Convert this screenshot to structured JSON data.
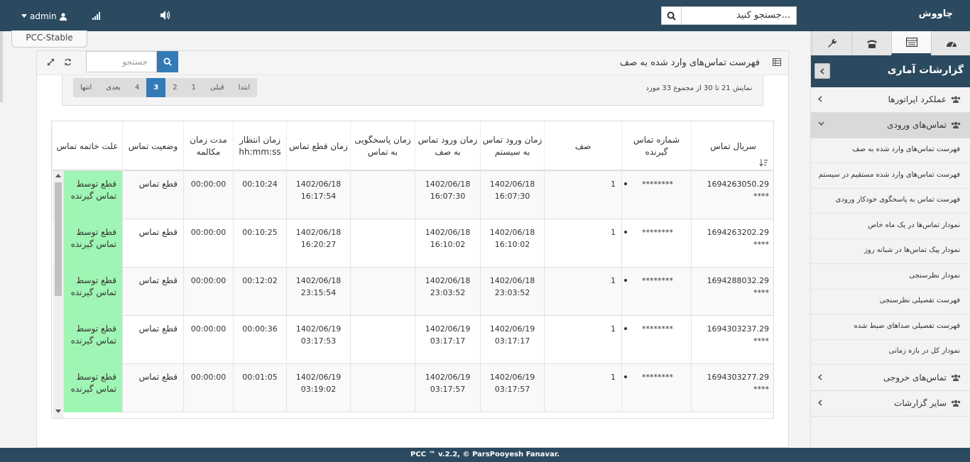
{
  "topbar": {
    "logo": "چاووش",
    "search_placeholder": "جستجو کنید...",
    "user": "admin"
  },
  "app_tab": "PCC-Stable",
  "panel": {
    "title": "فهرست تماس‌های وارد شده به صف",
    "search_placeholder": "جستجو"
  },
  "pager": {
    "info": "نمایش 21 تا 30 از مجموع 33 مورد",
    "pages": [
      "ابتدا",
      "قبلی",
      "1",
      "2",
      "3",
      "4",
      "بعدی",
      "انتها"
    ],
    "active": "3"
  },
  "table": {
    "headers": [
      "سریال تماس",
      "شماره تماس گیرنده",
      "صف",
      "زمان ورود تماس به سیستم",
      "زمان ورود تماس به صف",
      "زمان پاسخگویی به تماس",
      "زمان قطع تماس",
      "زمان انتظار hh:mm:ss",
      "مدت زمان مکالمه",
      "وضعیت تماس",
      "علت خاتمه تماس"
    ],
    "rows": [
      {
        "serial": "1694263050.29 ****",
        "caller": "********",
        "queue": "1",
        "sys_in_date": "1402/06/18",
        "sys_in_time": "16:07:30",
        "q_in_date": "1402/06/18",
        "q_in_time": "16:07:30",
        "answer": "",
        "end_date": "1402/06/18",
        "end_time": "16:17:54",
        "wait": "00:10:24",
        "talk": "00:00:00",
        "status": "قطع تماس",
        "reason": "قطع توسط تماس گیرنده"
      },
      {
        "serial": "1694263202.29 ****",
        "caller": "********",
        "queue": "1",
        "sys_in_date": "1402/06/18",
        "sys_in_time": "16:10:02",
        "q_in_date": "1402/06/18",
        "q_in_time": "16:10:02",
        "answer": "",
        "end_date": "1402/06/18",
        "end_time": "16:20:27",
        "wait": "00:10:25",
        "talk": "00:00:00",
        "status": "قطع تماس",
        "reason": "قطع توسط تماس گیرنده"
      },
      {
        "serial": "1694288032.29 ****",
        "caller": "********",
        "queue": "1",
        "sys_in_date": "1402/06/18",
        "sys_in_time": "23:03:52",
        "q_in_date": "1402/06/18",
        "q_in_time": "23:03:52",
        "answer": "",
        "end_date": "1402/06/18",
        "end_time": "23:15:54",
        "wait": "00:12:02",
        "talk": "00:00:00",
        "status": "قطع تماس",
        "reason": "قطع توسط تماس گیرنده"
      },
      {
        "serial": "1694303237.29 ****",
        "caller": "********",
        "queue": "1",
        "sys_in_date": "1402/06/19",
        "sys_in_time": "03:17:17",
        "q_in_date": "1402/06/19",
        "q_in_time": "03:17:17",
        "answer": "",
        "end_date": "1402/06/19",
        "end_time": "03:17:53",
        "wait": "00:00:36",
        "talk": "00:00:00",
        "status": "قطع تماس",
        "reason": "قطع توسط تماس گیرنده"
      },
      {
        "serial": "1694303277.29 ****",
        "caller": "********",
        "queue": "1",
        "sys_in_date": "1402/06/19",
        "sys_in_time": "03:17:57",
        "q_in_date": "1402/06/19",
        "q_in_time": "03:17:57",
        "answer": "",
        "end_date": "1402/06/19",
        "end_time": "03:19:02",
        "wait": "00:01:05",
        "talk": "00:00:00",
        "status": "قطع تماس",
        "reason": "قطع توسط تماس گیرنده"
      }
    ]
  },
  "sidebar": {
    "title": "گزارشات آماری",
    "groups": {
      "operators": "عملکرد اپراتورها",
      "incoming": "تماس‌های ورودی",
      "outgoing": "تماس‌های خروجی",
      "other": "سایر گزارشات"
    },
    "items": [
      "فهرست تماس‌های وارد شده به صف",
      "فهرست تماس‌های وارد شده مستقیم در سیستم",
      "فهرست تماس به پاسخگوی خودکار ورودی",
      "نمودار تماس‌ها در یک ماه خاص",
      "نمودار پیک تماس‌ها در شبانه روز",
      "نمودار نظرسنجی",
      "فهرست تفصیلی نظرسنجی",
      "فهرست تفصیلی صداهای ضبط شده",
      "نمودار کل در بازه زمانی"
    ]
  },
  "footer": "PCC ™ v.2.2, © ParsPooyesh Fanavar."
}
